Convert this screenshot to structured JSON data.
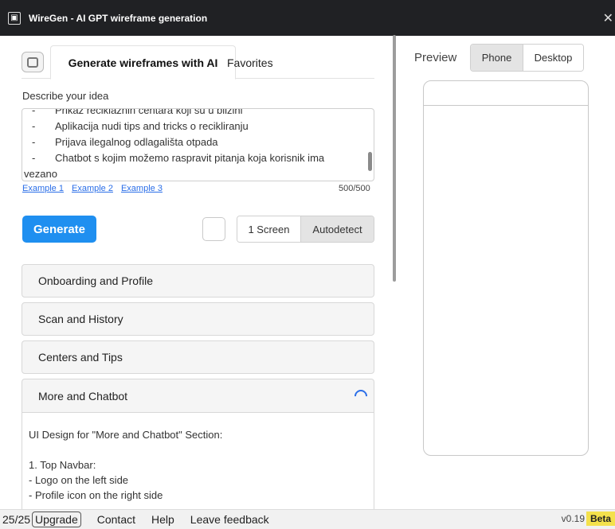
{
  "window": {
    "title": "WireGen - AI GPT wireframe generation",
    "close_glyph": "✕"
  },
  "tabs": {
    "generate": "Generate wireframes with AI",
    "favorites": "Favorites"
  },
  "describe": {
    "label": "Describe your idea",
    "lines": [
      {
        "dash": "-",
        "text": "Prikaz reciklaznih centara koji su u blizini"
      },
      {
        "dash": "-",
        "text": "Aplikacija nudi tips and tricks o recikliranju"
      },
      {
        "dash": "-",
        "text": "Prijava ilegalnog odlagališta otpada"
      },
      {
        "dash": "-",
        "text": "Chatbot s kojim možemo raspravit pitanja koja korisnik ima"
      },
      {
        "dash": "",
        "text": "vezano"
      }
    ],
    "examples": [
      "Example 1",
      "Example 2",
      "Example 3"
    ],
    "counter": "500/500"
  },
  "controls": {
    "generate": "Generate",
    "screen_one": "1 Screen",
    "screen_auto": "Autodetect"
  },
  "sections": [
    {
      "title": "Onboarding and Profile"
    },
    {
      "title": "Scan and History"
    },
    {
      "title": "Centers and Tips"
    },
    {
      "title": "More and Chatbot",
      "body": [
        "UI Design for \"More and Chatbot\" Section:",
        "",
        "1. Top Navbar:",
        "- Logo on the left side",
        "- Profile icon on the right side"
      ]
    }
  ],
  "preview": {
    "label": "Preview",
    "phone": "Phone",
    "desktop": "Desktop"
  },
  "footer": {
    "count": "25/25",
    "upgrade": "Upgrade",
    "contact": "Contact",
    "help": "Help",
    "feedback": "Leave feedback",
    "version": "v0.19",
    "beta": "Beta"
  }
}
